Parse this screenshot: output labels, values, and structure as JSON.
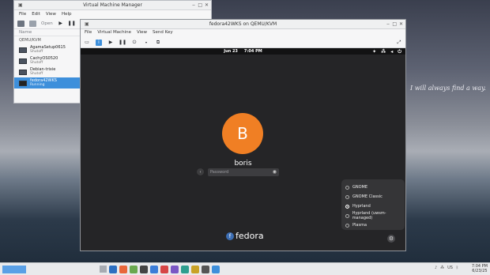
{
  "wallpaper": {
    "quote": "I will always find a way."
  },
  "vmm": {
    "title": "Virtual Machine Manager",
    "menu": [
      "File",
      "Edit",
      "View",
      "Help"
    ],
    "toolbar": {
      "open_label": "Open"
    },
    "column_name": "Name",
    "group": "QEMU/KVM",
    "vms": [
      {
        "name": "AgamaSetup0615",
        "state": "Shutoff",
        "selected": false
      },
      {
        "name": "CachyOS0520",
        "state": "Shutoff",
        "selected": false
      },
      {
        "name": "Debian-trixie",
        "state": "Shutoff",
        "selected": false
      },
      {
        "name": "fedora42WKS",
        "state": "Running",
        "selected": true
      }
    ]
  },
  "console": {
    "title": "fedora42WKS on QEMU/KVM",
    "menu": [
      "File",
      "Virtual Machine",
      "View",
      "Send Key"
    ],
    "gdm": {
      "date": "Jun 23",
      "time": "7:04 PM",
      "avatar_letter": "B",
      "avatar_color": "#f07f24",
      "username": "boris",
      "password_placeholder": "Password",
      "brand": "fedora",
      "sessions": [
        {
          "label": "GNOME",
          "selected": false
        },
        {
          "label": "GNOME Classic",
          "selected": false
        },
        {
          "label": "Hyprland",
          "selected": true
        },
        {
          "label": "Hyprland (uwsm-managed)",
          "selected": false
        },
        {
          "label": "Plasma",
          "selected": false
        }
      ]
    }
  },
  "taskbar": {
    "tray_locale": "US",
    "clock_time": "7:04 PM",
    "clock_date": "6/23/25"
  }
}
